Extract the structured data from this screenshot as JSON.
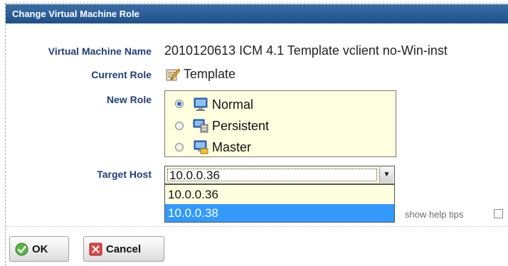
{
  "dialog": {
    "title": "Change Virtual Machine Role"
  },
  "fields": {
    "vm_name_label": "Virtual Machine Name",
    "vm_name_value": "2010120613 ICM 4.1 Template vclient no-Win-inst",
    "current_role_label": "Current Role",
    "current_role_value": "Template",
    "new_role_label": "New Role",
    "target_host_label": "Target Host"
  },
  "roles": [
    {
      "label": "Normal",
      "selected": true
    },
    {
      "label": "Persistent",
      "selected": false
    },
    {
      "label": "Master",
      "selected": false
    }
  ],
  "target_host": {
    "selected_value": "10.0.0.36",
    "options": [
      "10.0.0.36",
      "10.0.0.38"
    ],
    "highlighted_option": "10.0.0.38"
  },
  "help": {
    "label": "show help tips",
    "checked": false
  },
  "buttons": {
    "ok_label": "OK",
    "cancel_label": "Cancel"
  },
  "colors": {
    "title_bar": "#2a5d98",
    "label_text": "#1f3f78",
    "role_box_bg": "#ffffe0",
    "option_highlight": "#3399ff"
  },
  "icons": {
    "current_role": "template-pencil-icon",
    "roles": [
      "monitor-normal-icon",
      "monitor-persistent-icon",
      "monitor-master-icon"
    ],
    "ok": "check-circle-icon",
    "cancel": "x-box-icon"
  }
}
